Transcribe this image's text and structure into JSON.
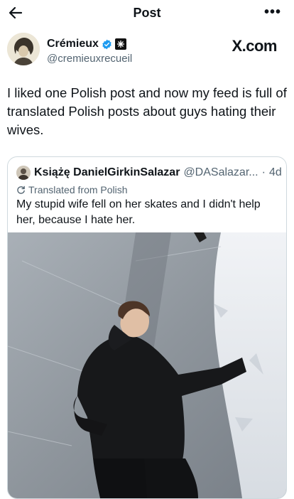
{
  "header": {
    "title": "Post",
    "back_icon": "arrow-left-icon",
    "more_icon": "more-horizontal-icon"
  },
  "author": {
    "name": "Crémieux",
    "handle": "@cremieuxrecueil",
    "verified_icon": "verified-badge-icon",
    "affiliate_icon": "affiliate-org-icon",
    "site_label": "X.com"
  },
  "post": {
    "text": "I liked one Polish post and now my feed is full of translated Polish posts about guys hating their wives."
  },
  "quoted_post": {
    "name": "Książę DanielGirkinSalazar",
    "handle": "@DASalazar...",
    "separator": "·",
    "time": "4d",
    "translated_label": "Translated from Polish",
    "text": "My stupid wife fell on her skates and I didn't help her, because I hate her."
  },
  "colors": {
    "text": "#0f1419",
    "secondary": "#536471",
    "verified": "#1d9bf0",
    "border": "#cfd9de"
  }
}
